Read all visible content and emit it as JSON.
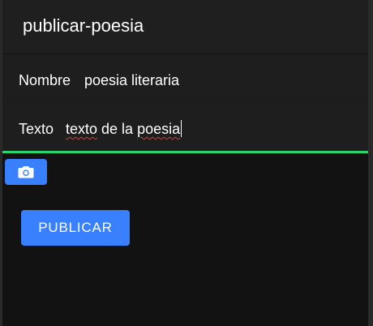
{
  "header": {
    "title": "publicar-poesia"
  },
  "form": {
    "nombre": {
      "label": "Nombre",
      "value": "poesia literaria"
    },
    "texto": {
      "label": "Texto",
      "value_plain": "texto",
      "value_rest": " de la ",
      "value_last": "poesia"
    }
  },
  "camera_button": {
    "icon": "camera-icon"
  },
  "publish_button": {
    "label": "PUBLICAR"
  },
  "colors": {
    "accent": "#3880ff",
    "focus_underline": "#2dd36f",
    "background": "#121212",
    "item_background": "#1e1e1e"
  }
}
